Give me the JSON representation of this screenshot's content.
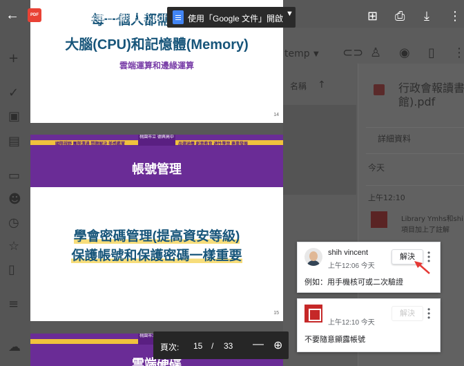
{
  "viewer": {
    "file_title": "行政會報讀書會(圖書館).pdf",
    "pdf_badge": "PDF",
    "open_with_label": "使用「Google 文件」開啟",
    "icons": [
      "back-arrow-icon",
      "add-comment-icon",
      "print-icon",
      "download-icon",
      "more-vert-icon"
    ]
  },
  "pages": {
    "p14": {
      "line1": "每一個人都需要另一個",
      "line2": "大腦(CPU)和記憶體(Memory)",
      "line3": "雲端運算和邊緣運算",
      "page_number": "14"
    },
    "p15": {
      "banner_left": "國際視野 團隊溝通 問題解決 美感鑑賞",
      "school_name": "桃園市立 德興高中",
      "banner_right": "品德涵養 創意教育 適性學習 專業發展",
      "heading": "帳號管理",
      "body_line1": "學會密碼管理(提高資安等級)",
      "body_line2": "保護帳號和保護密碼一樣重要",
      "page_number": "15"
    },
    "p16": {
      "school_name": "桃園市立 德興高中",
      "heading_partial": "雲端硬碟"
    }
  },
  "page_nav": {
    "label": "頁次:",
    "current": "15",
    "separator": "/",
    "total": "33"
  },
  "comments": [
    {
      "author": "shih vincent",
      "time": "上午12:06 今天",
      "resolve_label": "解決",
      "text": "例如：用手機核可或二次驗證"
    },
    {
      "author": "",
      "time": "上午12:10 今天",
      "resolve_label": "解決",
      "text": "不要隨意顯露帳號"
    }
  ],
  "background": {
    "folder_name": "temp",
    "column_header": "名稱",
    "details_title": "行政會報讀書館).pdf",
    "details_tab": "詳細資料",
    "today_label": "今天",
    "activity_time": "上午12:10",
    "activity_user": "Library Ymhs和shi",
    "activity_text": "項目加上了註解"
  }
}
